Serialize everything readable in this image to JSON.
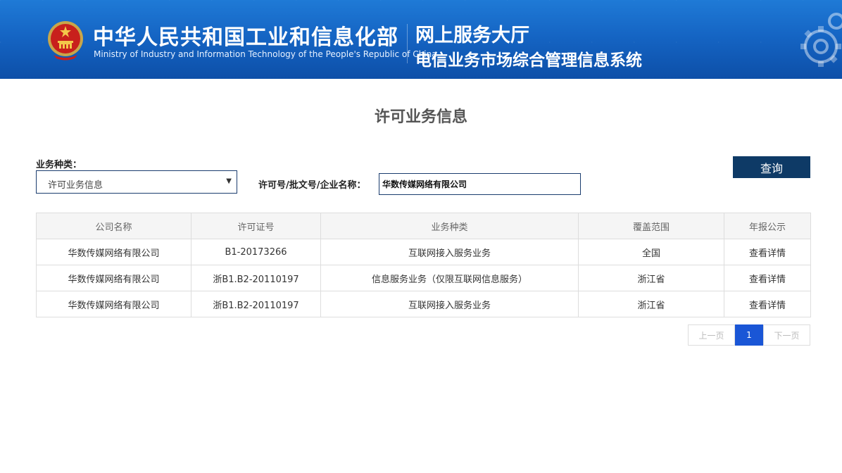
{
  "header": {
    "ministry_cn": "中华人民共和国工业和信息化部",
    "ministry_en": "Ministry of Industry and Information Technology of the People's Republic of China",
    "hall_title": "网上服务大厅",
    "system_title": "电信业务市场综合管理信息系统",
    "emblem_icon": "national-emblem-icon",
    "colors": {
      "banner_top": "#1f7ad6",
      "banner_bottom": "#0d4fa8"
    }
  },
  "page": {
    "title": "许可业务信息"
  },
  "search": {
    "type_label": "业务种类：",
    "type_selected": "许可业务信息",
    "keyword_label": "许可号/批文号/企业名称：",
    "keyword_value": "华数传媒网络有限公司",
    "query_label": "查询",
    "colors": {
      "button": "#0e3a66",
      "field_border": "#1a3c6e"
    }
  },
  "table": {
    "headers": [
      "公司名称",
      "许可证号",
      "业务种类",
      "覆盖范围",
      "年报公示"
    ],
    "rows": [
      [
        "华数传媒网络有限公司",
        "B1-20173266",
        "互联网接入服务业务",
        "全国",
        "查看详情"
      ],
      [
        "华数传媒网络有限公司",
        "浙B1.B2-20110197",
        "信息服务业务（仅限互联网信息服务）",
        "浙江省",
        "查看详情"
      ],
      [
        "华数传媒网络有限公司",
        "浙B1.B2-20110197",
        "互联网接入服务业务",
        "浙江省",
        "查看详情"
      ]
    ]
  },
  "pagination": {
    "prev": "上一页",
    "current": "1",
    "next": "下一页",
    "colors": {
      "active": "#1a56d6"
    }
  }
}
